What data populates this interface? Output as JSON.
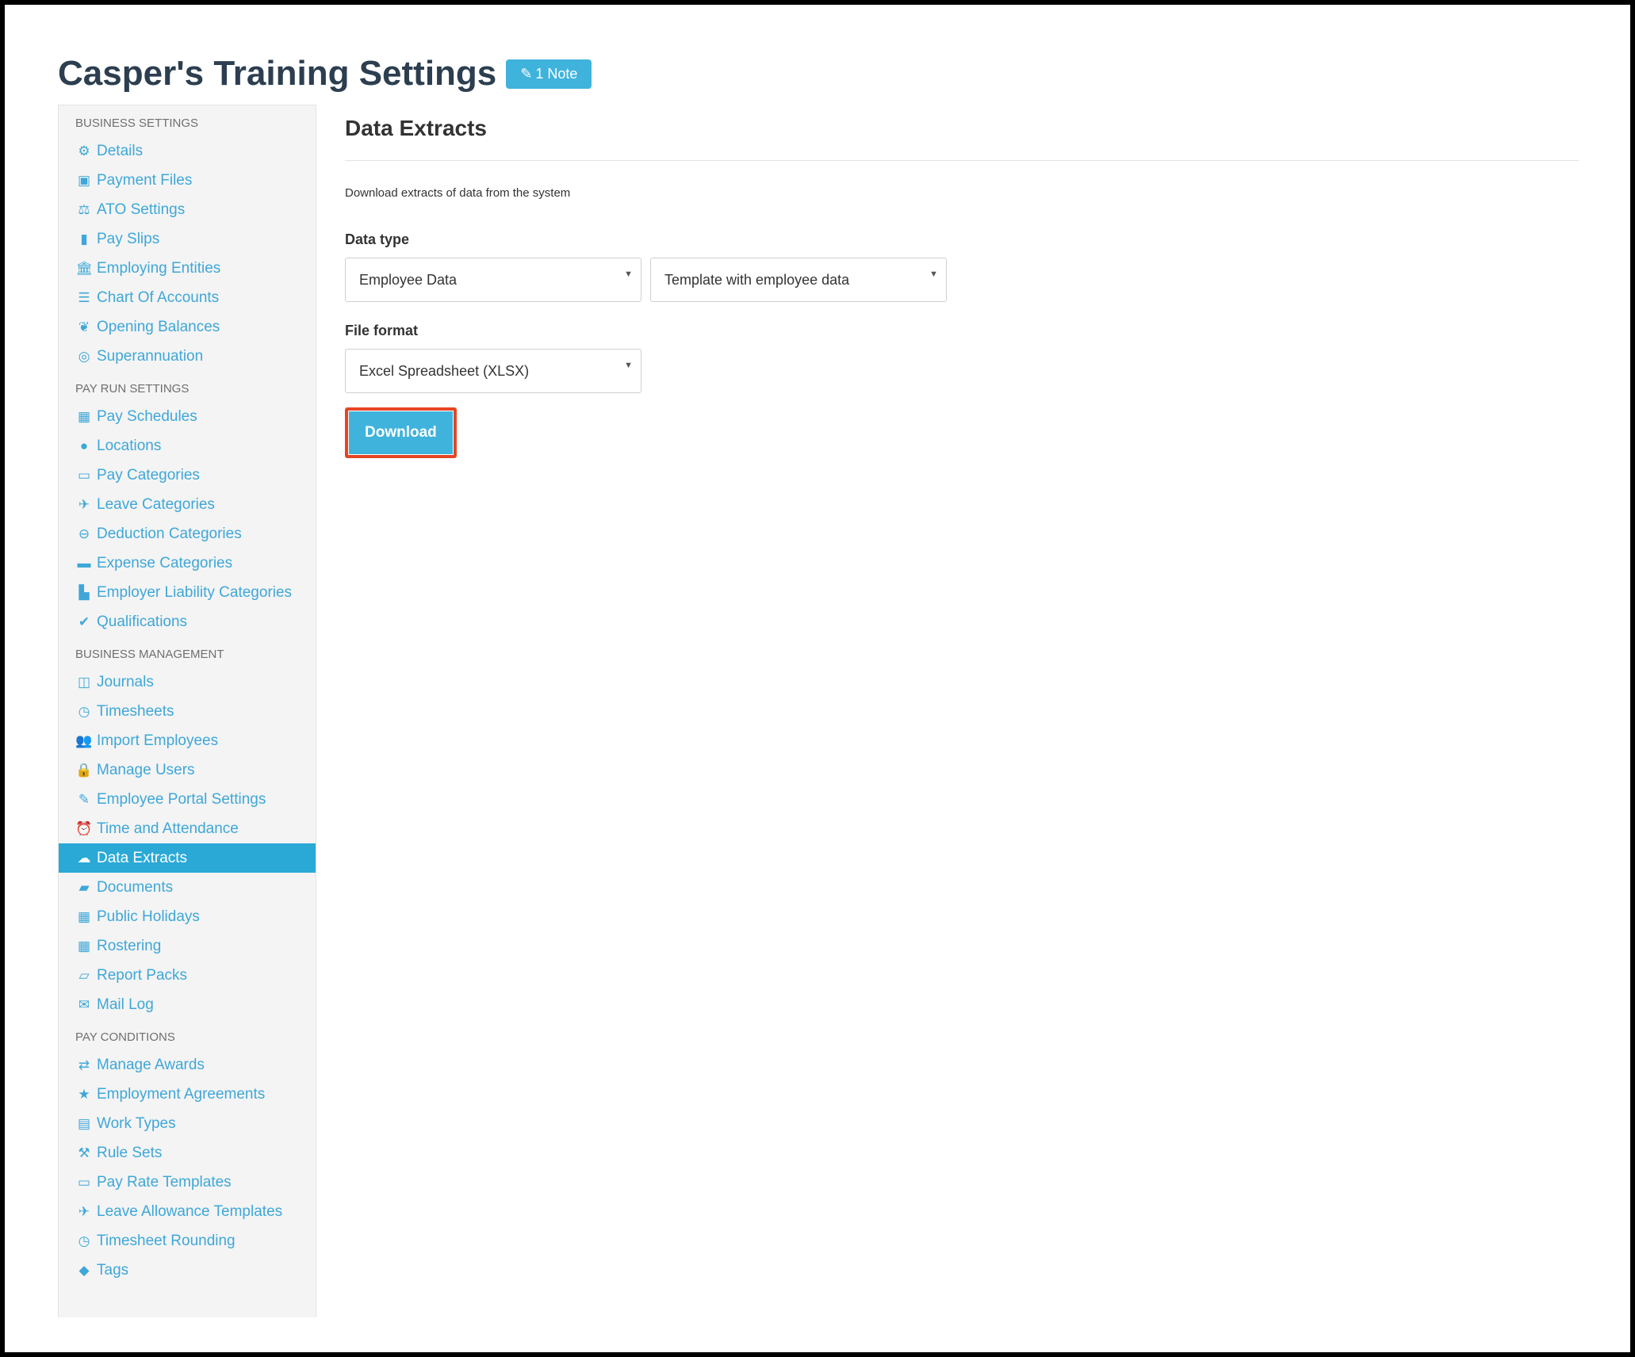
{
  "page": {
    "title": "Casper's Training Settings",
    "note_badge": "1 Note"
  },
  "sidebar": {
    "sections": [
      {
        "header": "BUSINESS SETTINGS",
        "items": [
          {
            "label": "Details",
            "icon": "gear-icon",
            "glyph": "⚙"
          },
          {
            "label": "Payment Files",
            "icon": "save-icon",
            "glyph": "▣"
          },
          {
            "label": "ATO Settings",
            "icon": "scale-icon",
            "glyph": "⚖"
          },
          {
            "label": "Pay Slips",
            "icon": "file-icon",
            "glyph": "▮"
          },
          {
            "label": "Employing Entities",
            "icon": "bank-icon",
            "glyph": "🏛"
          },
          {
            "label": "Chart Of Accounts",
            "icon": "list-icon",
            "glyph": "☰"
          },
          {
            "label": "Opening Balances",
            "icon": "leaf-icon",
            "glyph": "❦"
          },
          {
            "label": "Superannuation",
            "icon": "life-ring-icon",
            "glyph": "◎"
          }
        ]
      },
      {
        "header": "PAY RUN SETTINGS",
        "items": [
          {
            "label": "Pay Schedules",
            "icon": "calendar-icon",
            "glyph": "▦"
          },
          {
            "label": "Locations",
            "icon": "globe-icon",
            "glyph": "●"
          },
          {
            "label": "Pay Categories",
            "icon": "money-icon",
            "glyph": "▭"
          },
          {
            "label": "Leave Categories",
            "icon": "plane-icon",
            "glyph": "✈"
          },
          {
            "label": "Deduction Categories",
            "icon": "minus-circle-icon",
            "glyph": "⊖"
          },
          {
            "label": "Expense Categories",
            "icon": "archive-icon",
            "glyph": "▬"
          },
          {
            "label": "Employer Liability Categories",
            "icon": "industry-icon",
            "glyph": "▙"
          },
          {
            "label": "Qualifications",
            "icon": "check-icon",
            "glyph": "✔"
          }
        ]
      },
      {
        "header": "BUSINESS MANAGEMENT",
        "items": [
          {
            "label": "Journals",
            "icon": "columns-icon",
            "glyph": "◫"
          },
          {
            "label": "Timesheets",
            "icon": "clock-icon",
            "glyph": "◷"
          },
          {
            "label": "Import Employees",
            "icon": "users-icon",
            "glyph": "👥"
          },
          {
            "label": "Manage Users",
            "icon": "lock-icon",
            "glyph": "🔒"
          },
          {
            "label": "Employee Portal Settings",
            "icon": "magic-wand-icon",
            "glyph": "✎"
          },
          {
            "label": "Time and Attendance",
            "icon": "alarm-clock-icon",
            "glyph": "⏰"
          },
          {
            "label": "Data Extracts",
            "icon": "cloud-download-icon",
            "glyph": "☁",
            "active": true
          },
          {
            "label": "Documents",
            "icon": "folder-icon",
            "glyph": "▰"
          },
          {
            "label": "Public Holidays",
            "icon": "calendar-icon",
            "glyph": "▦"
          },
          {
            "label": "Rostering",
            "icon": "calendar-grid-icon",
            "glyph": "▦"
          },
          {
            "label": "Report Packs",
            "icon": "folder-open-icon",
            "glyph": "▱"
          },
          {
            "label": "Mail Log",
            "icon": "envelope-icon",
            "glyph": "✉"
          }
        ]
      },
      {
        "header": "PAY CONDITIONS",
        "items": [
          {
            "label": "Manage Awards",
            "icon": "exchange-icon",
            "glyph": "⇄"
          },
          {
            "label": "Employment Agreements",
            "icon": "star-icon",
            "glyph": "★"
          },
          {
            "label": "Work Types",
            "icon": "book-icon",
            "glyph": "▤"
          },
          {
            "label": "Rule Sets",
            "icon": "gavel-icon",
            "glyph": "⚒"
          },
          {
            "label": "Pay Rate Templates",
            "icon": "money-icon",
            "glyph": "▭"
          },
          {
            "label": "Leave Allowance Templates",
            "icon": "plane-icon",
            "glyph": "✈"
          },
          {
            "label": "Timesheet Rounding",
            "icon": "clock-icon",
            "glyph": "◷"
          },
          {
            "label": "Tags",
            "icon": "tag-icon",
            "glyph": "◆"
          }
        ]
      }
    ]
  },
  "main": {
    "title": "Data Extracts",
    "description": "Download extracts of data from the system",
    "data_type_label": "Data type",
    "data_type_value": "Employee Data",
    "template_value": "Template with employee data",
    "file_format_label": "File format",
    "file_format_value": "Excel Spreadsheet (XLSX)",
    "download_label": "Download"
  },
  "colors": {
    "accent": "#3fb3dc",
    "active_nav": "#2aa9d7",
    "highlight_border": "#e64524"
  }
}
